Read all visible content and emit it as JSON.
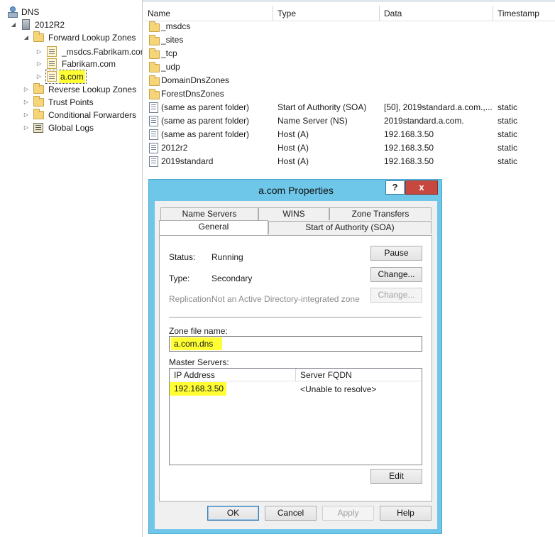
{
  "tree": {
    "items": [
      {
        "label": "DNS",
        "icon": "dns-icon"
      },
      {
        "label": "2012R2",
        "icon": "server-icon"
      },
      {
        "label": "Forward Lookup Zones",
        "icon": "folder-icon"
      },
      {
        "label": "_msdcs.Fabrikam.cor",
        "icon": "zone-icon"
      },
      {
        "label": "Fabrikam.com",
        "icon": "zone-icon"
      },
      {
        "label": "a.com",
        "icon": "zone-icon"
      },
      {
        "label": "Reverse Lookup Zones",
        "icon": "folder-icon"
      },
      {
        "label": "Trust Points",
        "icon": "folder-icon"
      },
      {
        "label": "Conditional Forwarders",
        "icon": "folder-icon"
      },
      {
        "label": "Global Logs",
        "icon": "log-icon"
      }
    ]
  },
  "list": {
    "columns": [
      "Name",
      "Type",
      "Data",
      "Timestamp"
    ],
    "rows": [
      {
        "name": "_msdcs",
        "type": "",
        "data": "",
        "timestamp": "",
        "icon": "folder-icon"
      },
      {
        "name": "_sites",
        "type": "",
        "data": "",
        "timestamp": "",
        "icon": "folder-icon"
      },
      {
        "name": "_tcp",
        "type": "",
        "data": "",
        "timestamp": "",
        "icon": "folder-icon"
      },
      {
        "name": "_udp",
        "type": "",
        "data": "",
        "timestamp": "",
        "icon": "folder-icon"
      },
      {
        "name": "DomainDnsZones",
        "type": "",
        "data": "",
        "timestamp": "",
        "icon": "folder-icon"
      },
      {
        "name": "ForestDnsZones",
        "type": "",
        "data": "",
        "timestamp": "",
        "icon": "folder-icon"
      },
      {
        "name": "(same as parent folder)",
        "type": "Start of Authority (SOA)",
        "data": "[50], 2019standard.a.com.,...",
        "timestamp": "static",
        "icon": "record-icon"
      },
      {
        "name": "(same as parent folder)",
        "type": "Name Server (NS)",
        "data": "2019standard.a.com.",
        "timestamp": "static",
        "icon": "record-icon"
      },
      {
        "name": "(same as parent folder)",
        "type": "Host (A)",
        "data": "192.168.3.50",
        "timestamp": "static",
        "icon": "record-icon"
      },
      {
        "name": "2012r2",
        "type": "Host (A)",
        "data": "192.168.3.50",
        "timestamp": "static",
        "icon": "record-icon"
      },
      {
        "name": "2019standard",
        "type": "Host (A)",
        "data": "192.168.3.50",
        "timestamp": "static",
        "icon": "record-icon"
      }
    ]
  },
  "dialog": {
    "title": "a.com Properties",
    "help_glyph": "?",
    "close_glyph": "x",
    "tabs_back": [
      "Name Servers",
      "WINS",
      "Zone Transfers"
    ],
    "tabs_front": [
      "General",
      "Start of Authority (SOA)"
    ],
    "status_label": "Status:",
    "status_value": "Running",
    "type_label": "Type:",
    "type_value": "Secondary",
    "replication_label": "Replication:",
    "replication_value": "Not an Active Directory-integrated zone",
    "pause_button": "Pause",
    "change_type_button": "Change...",
    "change_replication_button": "Change...",
    "zone_file_label": "Zone file name:",
    "zone_file_value": "a.com.dns",
    "master_servers_label": "Master Servers:",
    "master_columns": [
      "IP Address",
      "Server FQDN"
    ],
    "master_rows": [
      {
        "ip": "192.168.3.50",
        "fqdn": "<Unable to resolve>"
      }
    ],
    "edit_button": "Edit",
    "ok_button": "OK",
    "cancel_button": "Cancel",
    "apply_button": "Apply",
    "help_button": "Help"
  },
  "colors": {
    "highlight": "#ffff33",
    "dialog_frame": "#6ec6e8",
    "close_button": "#c7483f"
  }
}
